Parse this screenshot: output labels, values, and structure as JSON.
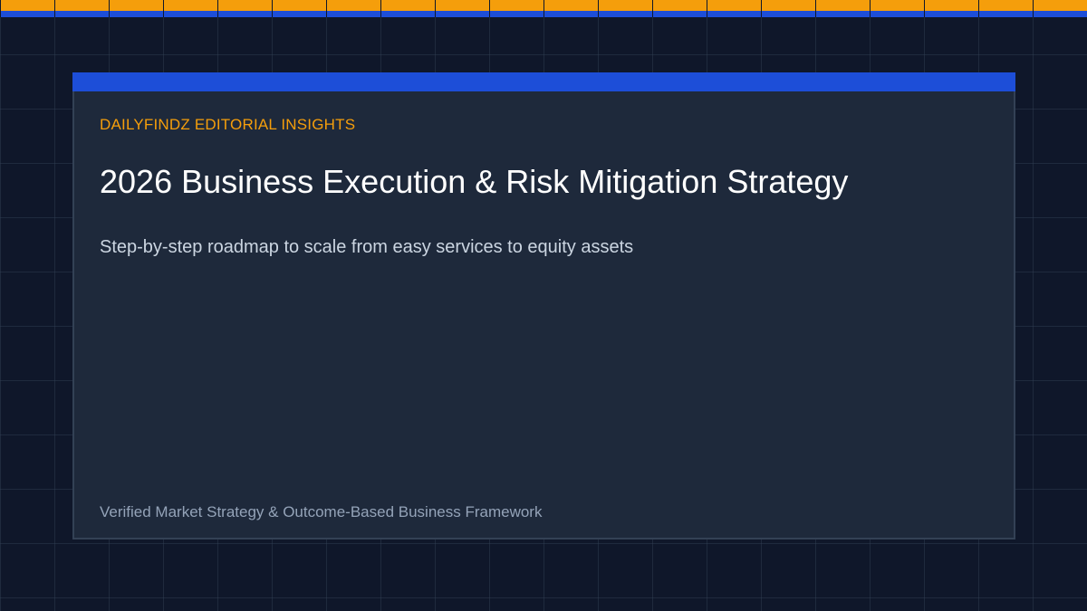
{
  "kicker": "DAILYFINDZ EDITORIAL INSIGHTS",
  "headline": "2026 Business Execution & Risk Mitigation Strategy",
  "subhead": "Step-by-step roadmap to scale from easy services to equity assets",
  "footer_note": "Verified Market Strategy & Outcome-Based Business Framework",
  "colors": {
    "background": "#0f172a",
    "card": "#1e293b",
    "accent_blue": "#1d4ed8",
    "accent_orange": "#f59e0b",
    "headline": "#ffffff",
    "subhead": "#cbd5e1",
    "footer_note": "#94a3b8"
  }
}
